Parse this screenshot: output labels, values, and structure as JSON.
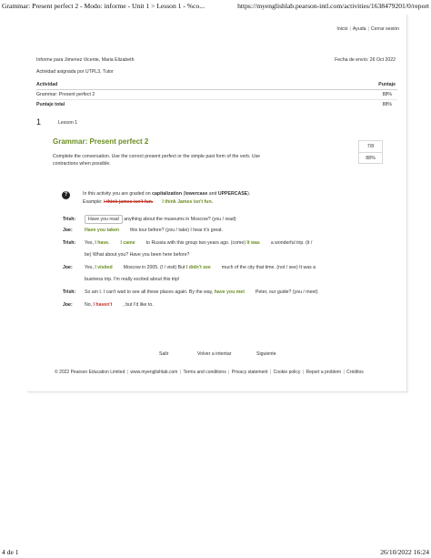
{
  "print_header": {
    "left": "Grammar: Present perfect 2 - Modo: informe - Unit 1 > Lesson 1 - %co...",
    "right": "https://myenglishlab.pearson-intl.com/activities/1638479201/0/report"
  },
  "print_footer": {
    "left": "4 de 1",
    "right": "26/10/2022 16:24"
  },
  "top_links": {
    "home": "Inicio",
    "help": "Ayuda",
    "logout": "Cerrar sesión"
  },
  "report": {
    "for_label": "Informe para Jimenez Vicente, Maria Elizabeth",
    "sent_date": "Fecha de envío: 26 Oct 2022",
    "assigned": "Actividad asignada por UTPL3, Tutor"
  },
  "summary_table": {
    "col_activity": "Actividad",
    "col_score": "Puntaje",
    "row_name": "Grammar: Present perfect 2",
    "row_score": "88%",
    "total_label": "Puntaje total",
    "total_score": "88%"
  },
  "lesson": {
    "number": "1",
    "label": "Lesson 1"
  },
  "question": {
    "title": "Grammar: Present perfect 2",
    "score_fraction": "7/8",
    "score_pct": "88%",
    "instructions_1": "Complete the conversation. Use the correct present perfect or the simple past form of the verb. Use",
    "instructions_2": "contractions when possible."
  },
  "note": {
    "pre": "In this activity you are graded on ",
    "cap": "capitalization",
    "mid": " (",
    "lower": "lowercase",
    "and": " and ",
    "upper": "UPPERCASE",
    "end": ").",
    "example_label": "Example: ",
    "example_wrong": "i think james isn't fun.",
    "example_right": "I think James isn't fun."
  },
  "dialogue": {
    "l1": {
      "speaker": "Trish:",
      "ans": "Have you read",
      "rest": "anything about the museums in Moscow? (you / read)"
    },
    "l2": {
      "speaker": "Joe:",
      "ans": "Have you taken",
      "rest": "this tour before? (you / take) I hear it's great."
    },
    "l3": {
      "speaker": "Trish:",
      "pre": "Yes, ",
      "ans1": "I have.",
      "ans2": "I came",
      "mid": "to Russia with this group two years ago. (come) ",
      "ans3": "It was",
      "rest": "a wonderful trip. (it /"
    },
    "l3b": "be) What about you? Have you been here before?",
    "l4": {
      "speaker": "Joe:",
      "pre": "Yes, ",
      "ans1": "I visited",
      "mid": "Moscow in 2005. (I / visit) But ",
      "ans2": "I didn't see",
      "rest": "much of the city that time. (not / see) It was a"
    },
    "l4b": "business trip. I'm really excited about this trip!",
    "l5": {
      "speaker": "Trish:",
      "pre": "So am I. I can't wait to see all these places again. By the way, ",
      "ans": "have you met",
      "rest": "Peter, our guide? (you / meet)"
    },
    "l6": {
      "speaker": "Joe:",
      "pre": "No, ",
      "ans": "I haven't",
      "rest": ", but I'd like to."
    }
  },
  "nav": {
    "exit": "Salir",
    "retry": "Volver a intentar",
    "next": "Siguiente"
  },
  "footer": {
    "copyright": "© 2022 Pearson Education Limited",
    "site": "www.myenglishlab.com",
    "terms": "Terms and conditions",
    "privacy": "Privacy statement",
    "cookie": "Cookie policy",
    "report": "Report a problem",
    "credits": "Créditos"
  },
  "colors": {
    "accent_green": "#6b8e23",
    "error_red": "#c0392b"
  }
}
